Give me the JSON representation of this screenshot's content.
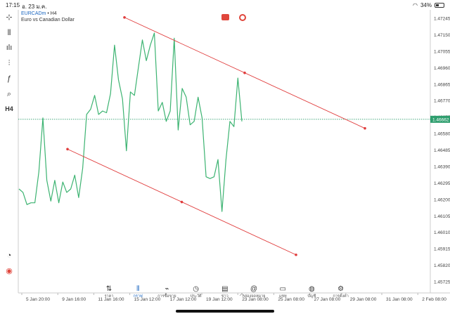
{
  "status": {
    "time": "17:15",
    "date": "อ. 23 ม.ค.",
    "battery": "34%",
    "battery_level": 0.34
  },
  "symbol": {
    "name": "EURCADm",
    "timeframe": " • H4",
    "description": "Euro vs Canadian Dollar"
  },
  "toolbar": [
    {
      "name": "crosshair-icon",
      "glyph": "⊹"
    },
    {
      "name": "candles-icon",
      "glyph": "⫴"
    },
    {
      "name": "indicators-icon",
      "glyph": "ılı"
    },
    {
      "name": "objects-icon",
      "glyph": "⫶"
    },
    {
      "name": "function-icon",
      "glyph": "ƒ"
    },
    {
      "name": "shapes-icon",
      "glyph": "⌕"
    },
    {
      "name": "timeframe-label",
      "glyph": "H4"
    }
  ],
  "toolbar_bottom": [
    {
      "name": "history-icon",
      "glyph": "◔"
    },
    {
      "name": "brand-icon",
      "glyph": "◉"
    }
  ],
  "price_axis": [
    "1.47245",
    "1.47150",
    "1.47055",
    "1.46960",
    "1.46865",
    "1.46770",
    "1.46675",
    "1.46580",
    "1.46485",
    "1.46390",
    "1.46295",
    "1.46200",
    "1.46105",
    "1.46010",
    "1.45915",
    "1.45820",
    "1.45725"
  ],
  "current_price": "1.46662",
  "time_axis": [
    "5 Jan 20:00",
    "9 Jan 16:00",
    "11 Jan 16:00",
    "15 Jan 12:00",
    "17 Jan 12:00",
    "19 Jan 12:00",
    "23 Jan 08:00",
    "25 Jan 08:00",
    "27 Jan 08:00",
    "29 Jan 08:00",
    "31 Jan 08:00",
    "2 Feb 08:00"
  ],
  "price_line": [
    1.4626,
    1.4624,
    1.4617,
    1.4618,
    1.4618,
    1.4636,
    1.4667,
    1.4631,
    1.4619,
    1.4631,
    1.4618,
    1.463,
    1.4624,
    1.4626,
    1.4634,
    1.4621,
    1.4638,
    1.4669,
    1.4672,
    1.468,
    1.4669,
    1.4671,
    1.467,
    1.4681,
    1.4709,
    1.4689,
    1.4678,
    1.4648,
    1.4682,
    1.468,
    1.4696,
    1.4712,
    1.47,
    1.4709,
    1.4716,
    1.4671,
    1.4676,
    1.4665,
    1.4671,
    1.4713,
    1.466,
    1.4684,
    1.4679,
    1.4663,
    1.4665,
    1.4679,
    1.4667,
    1.4633,
    1.4632,
    1.4633,
    1.4643,
    1.4613,
    1.4643,
    1.4665,
    1.4662,
    1.469,
    1.4665
  ],
  "channel": {
    "upper": {
      "start": 1.4725,
      "end": 1.4661
    },
    "lower": {
      "start": 1.4649,
      "end": 1.4588
    }
  },
  "colors": {
    "line": "#3cb371",
    "trend": "#e03c3c",
    "price_tag": "#2e9e6e",
    "accent": "#1a66c0"
  },
  "nav": [
    {
      "name": "nav-quotes",
      "icon": "⇅",
      "label": "ราคา",
      "active": false
    },
    {
      "name": "nav-chart",
      "icon": "⫴",
      "label": "กราฟ",
      "active": true
    },
    {
      "name": "nav-trade",
      "icon": "⌁",
      "label": "การซื้อขาย",
      "active": false
    },
    {
      "name": "nav-history",
      "icon": "◷",
      "label": "ประวัติ",
      "active": false
    },
    {
      "name": "nav-news",
      "icon": "▤",
      "label": "ข่าว",
      "active": false
    },
    {
      "name": "nav-mailbox",
      "icon": "@",
      "label": "กล่องจดหมาย",
      "active": false
    },
    {
      "name": "nav-chat",
      "icon": "▭",
      "label": "แชท",
      "active": false
    },
    {
      "name": "nav-account",
      "icon": "◍",
      "label": "บัญชี",
      "active": false
    },
    {
      "name": "nav-settings",
      "icon": "⚙",
      "label": "การตั้งค่า",
      "active": false
    }
  ]
}
